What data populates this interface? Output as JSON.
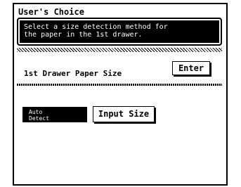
{
  "window": {
    "title": "User's Choice"
  },
  "instruction": {
    "line1": "Select a size detection method for",
    "line2": "the paper in the 1st drawer."
  },
  "panel": {
    "title": "1st Drawer Paper Size",
    "enter_label": "Enter"
  },
  "options": {
    "auto_line1": "Auto",
    "auto_line2": "Detect",
    "input_size_label": "Input Size"
  }
}
